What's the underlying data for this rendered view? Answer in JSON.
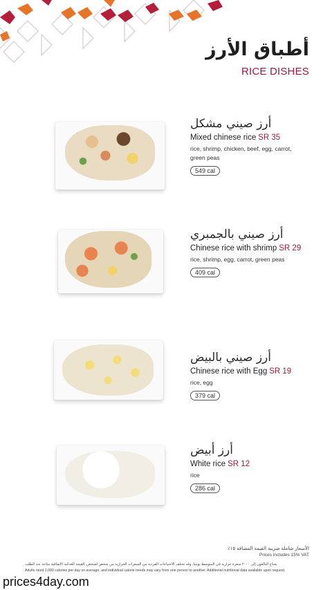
{
  "header": {
    "title_ar": "أطباق الأرز",
    "title_en": "RICE DISHES"
  },
  "colors": {
    "accent": "#9b1b3a",
    "pattern_red": "#b51e3a",
    "pattern_orange": "#e8742a"
  },
  "dishes": [
    {
      "name_ar": "أرز صيني مشكل",
      "name_en": "Mixed chinese rice",
      "price": "SR 35",
      "ingredients": "rice, shrimp, chicken, beef, egg, carrot, green peas",
      "calories": "549 cal"
    },
    {
      "name_ar": "أرز صيني بالجمبري",
      "name_en": "Chinese rice with shrimp",
      "price": "SR 29",
      "ingredients": "rice, shrimp, egg, carrot, green peas",
      "calories": "409 cal"
    },
    {
      "name_ar": "أرز صيني بالبيض",
      "name_en": "Chinese rice with Egg",
      "price": "SR 19",
      "ingredients": "rice, egg",
      "calories": "379 cal"
    },
    {
      "name_ar": "أرز أبيض",
      "name_en": "White rice",
      "price": "SR 12",
      "ingredients": "rice",
      "calories": "286 cal"
    }
  ],
  "footer": {
    "vat_ar": "الأسعار شاملة ضريبة القيمة المضافة ١٥٪",
    "vat_en": "Prices includes 15% VAT",
    "note_ar": "يحتاج البالغون إلى ٢٠٠٠ سعرة حرارية في المتوسط يومياً، وقد تختلف الاحتياجات الفردية من السعرات الحرارية من شخص لشخص. القيمة الغذائية الإضافية متاحة عند الطلب",
    "note_en": "Adults need 2,000 calories per day on average, and individual calorie needs may vary from one person to another. Additional nutritional data available upon request."
  },
  "watermark": "prices4day.com"
}
